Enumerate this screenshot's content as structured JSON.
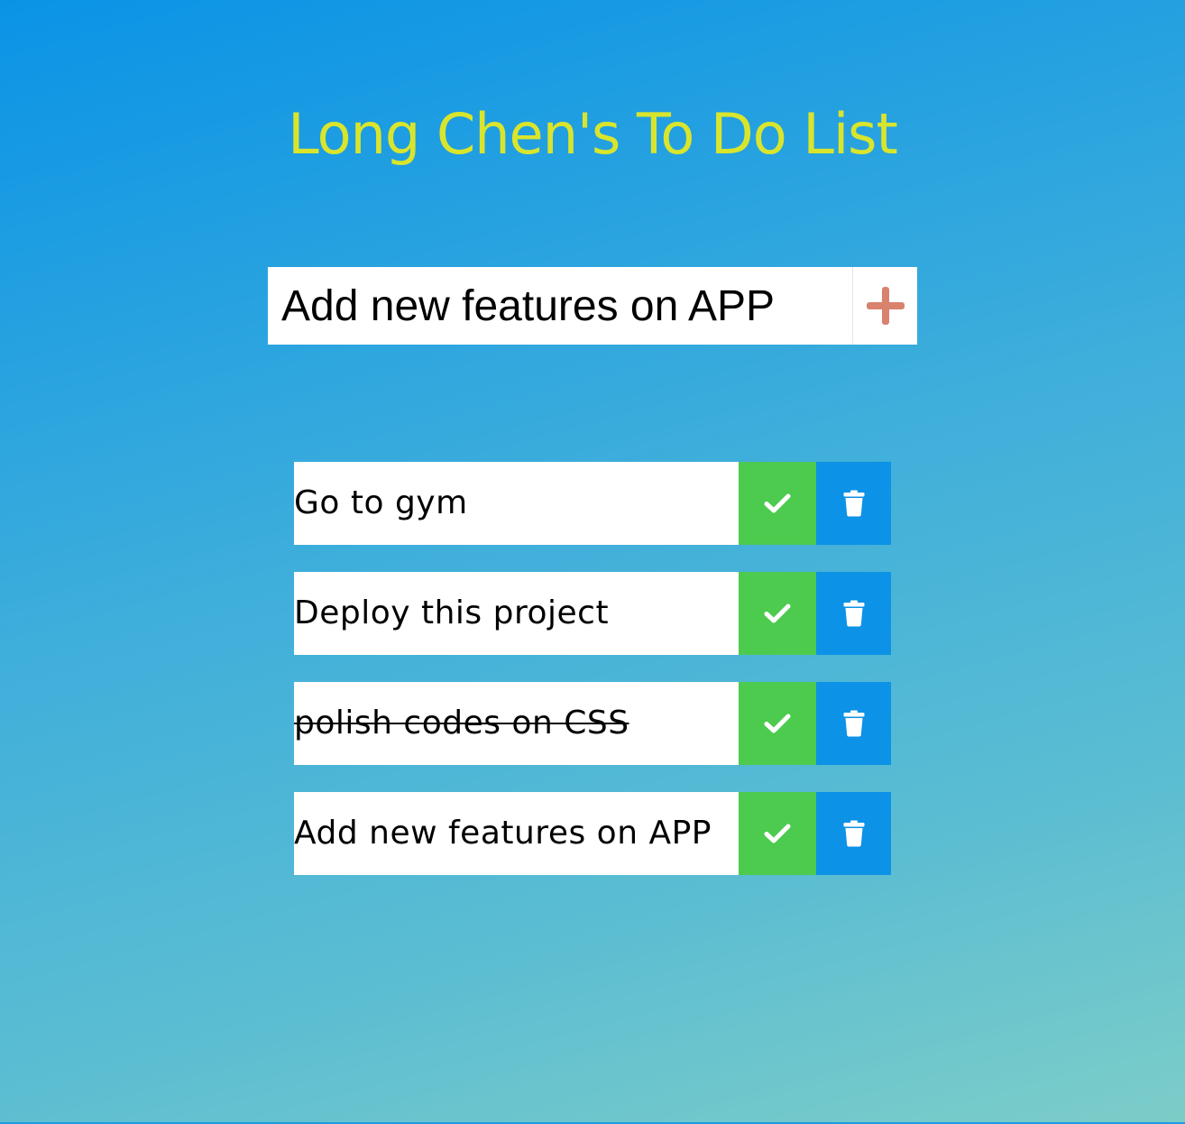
{
  "header": {
    "title": "Long Chen's To Do List"
  },
  "add_form": {
    "input_value": "Add new features on APP",
    "add_icon": "plus-icon",
    "add_icon_color": "#d9826d"
  },
  "todos": [
    {
      "text": "Go to gym",
      "completed": false
    },
    {
      "text": "Deploy this project",
      "completed": false
    },
    {
      "text": "polish codes on CSS",
      "completed": true
    },
    {
      "text": "Add new features on APP",
      "completed": false
    }
  ],
  "icons": {
    "complete": "check-icon",
    "delete": "trash-icon"
  },
  "colors": {
    "title": "#d9e52c",
    "complete_button": "#4dcb4f",
    "delete_button": "#0c92e6",
    "background_top": "#0a93e6",
    "background_bottom": "#7ccdc8"
  }
}
